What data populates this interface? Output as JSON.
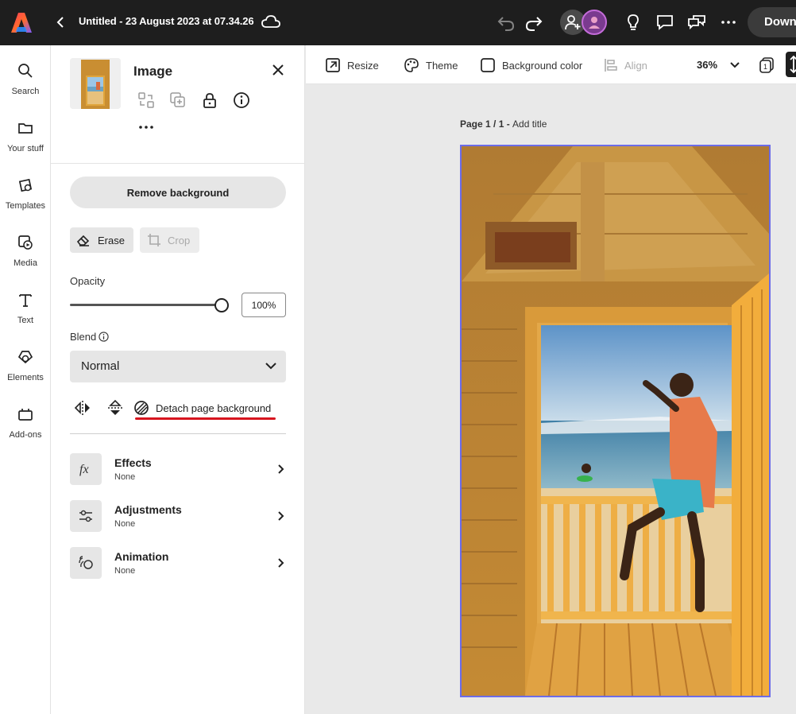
{
  "topbar": {
    "doc_title": "Untitled - 23 August 2023 at 07.34.26",
    "download_label": "Down"
  },
  "rail": {
    "items": [
      {
        "label": "Search",
        "icon": "search-icon"
      },
      {
        "label": "Your stuff",
        "icon": "folder-icon"
      },
      {
        "label": "Templates",
        "icon": "templates-icon"
      },
      {
        "label": "Media",
        "icon": "media-icon"
      },
      {
        "label": "Text",
        "icon": "text-icon"
      },
      {
        "label": "Elements",
        "icon": "elements-icon"
      },
      {
        "label": "Add-ons",
        "icon": "add-ons-icon"
      }
    ]
  },
  "panel": {
    "title": "Image",
    "remove_background": "Remove background",
    "erase": "Erase",
    "crop": "Crop",
    "opacity_label": "Opacity",
    "opacity_value": "100%",
    "opacity_level": 1.0,
    "blend_label": "Blend",
    "blend_value": "Normal",
    "detach": "Detach page background",
    "properties": [
      {
        "title": "Effects",
        "value": "None",
        "icon": "fx-icon"
      },
      {
        "title": "Adjustments",
        "value": "None",
        "icon": "sliders-icon"
      },
      {
        "title": "Animation",
        "value": "None",
        "icon": "animation-icon"
      }
    ]
  },
  "canvas_toolbar": {
    "resize": "Resize",
    "theme": "Theme",
    "background_color": "Background color",
    "align": "Align",
    "zoom": "36%"
  },
  "canvas": {
    "page_label": "Page 1 / 1 - ",
    "page_title_placeholder": "Add title"
  },
  "colors": {
    "selection": "#6c6ce8",
    "underline": "#d7151f",
    "topbar": "#1e1e1e"
  }
}
